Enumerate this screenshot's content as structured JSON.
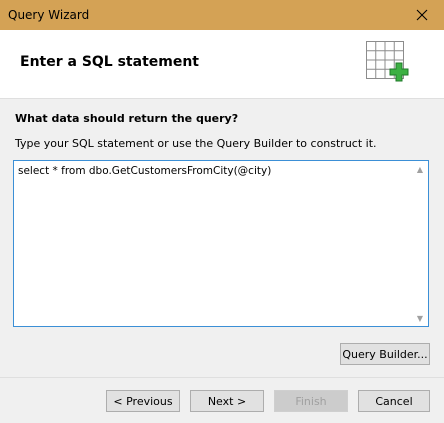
{
  "window": {
    "title": "Query Wizard",
    "close_icon": "close-icon",
    "titlebar_color": "#d4a255"
  },
  "header": {
    "heading": "Enter a SQL statement",
    "icon": "table-add-icon",
    "icon_accent": "#3cb043"
  },
  "content": {
    "question": "What data should return the query?",
    "instruction": "Type your SQL statement or use the Query Builder to construct it.",
    "sql_value": "select * from dbo.GetCustomersFromCity(@city)",
    "query_builder_label": "Query Builder..."
  },
  "footer": {
    "previous_label": "< Previous",
    "next_label": "Next >",
    "finish_label": "Finish",
    "finish_enabled": false,
    "cancel_label": "Cancel"
  }
}
